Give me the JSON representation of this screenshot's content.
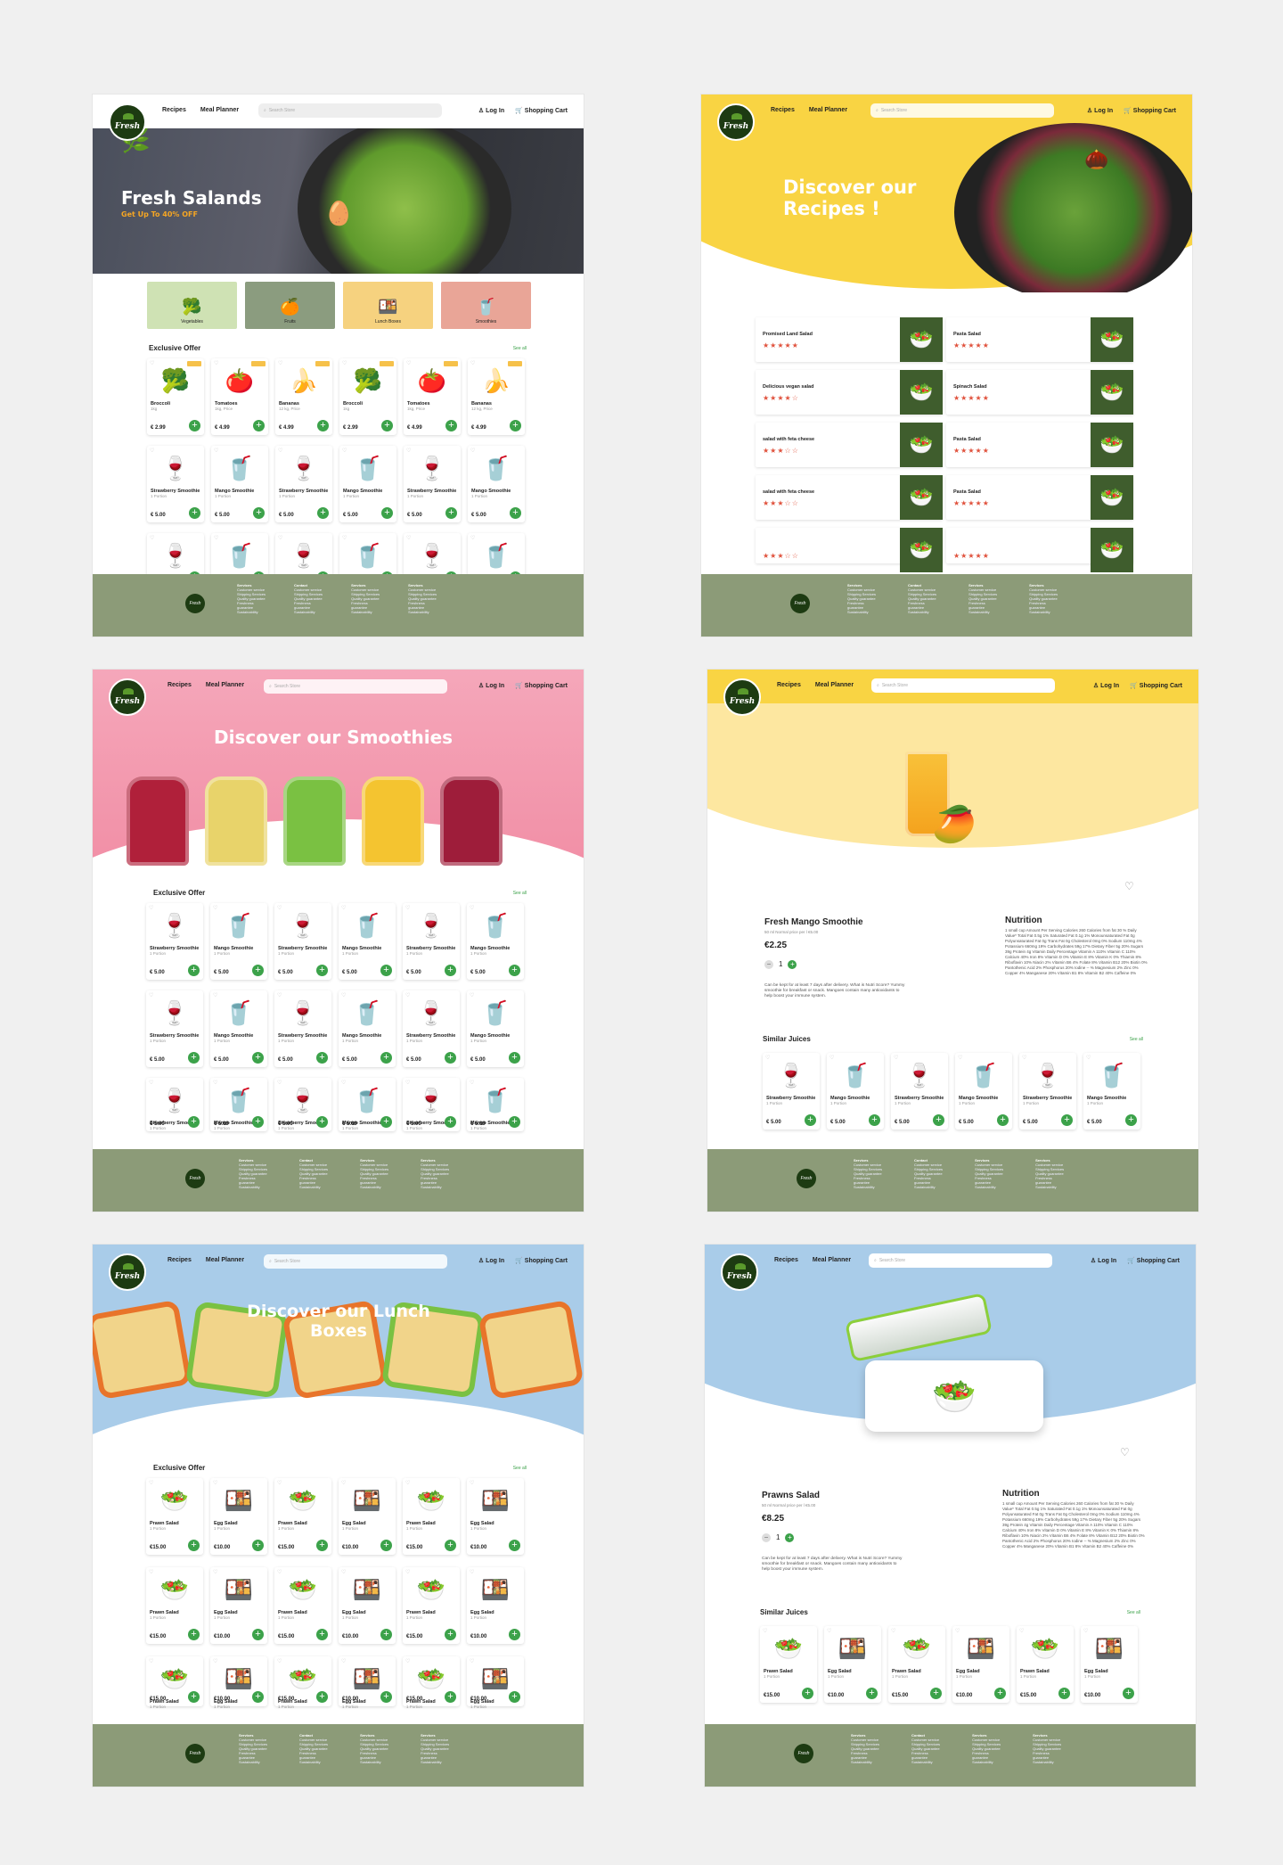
{
  "nav": {
    "links": [
      "Recipes",
      "Meal Planner"
    ],
    "search_placeholder": "Search Store",
    "login": "Log In",
    "cart": "Shopping Cart",
    "logo": "Fresh"
  },
  "colors": {
    "green": "#3ca24a",
    "footer": "#8c9b78",
    "yellow": "#f9d443",
    "pink": "#f3a3b5",
    "blue": "#a9cce9",
    "dark_green": "#1d3b12"
  },
  "page1": {
    "hero_title": "Fresh Salands",
    "hero_sub": "Get Up To 40% OFF",
    "categories": [
      {
        "label": "Vegetables",
        "icon": "broccoli-icon",
        "bg": "#cfe2b4"
      },
      {
        "label": "Fruits",
        "icon": "fruit-icon",
        "bg": "#8b9c7f"
      },
      {
        "label": "Lunch Boxes",
        "icon": "lunchbox-icon",
        "bg": "#f6d27f"
      },
      {
        "label": "Smoothies",
        "icon": "smoothie-icon",
        "bg": "#e9a597"
      }
    ],
    "section": "Exclusive Offer",
    "see_all": "See all",
    "row1": [
      {
        "name": "Broccoli",
        "sub": "1kg",
        "price": "€ 2.99",
        "icon": "🥦"
      },
      {
        "name": "Tomatoes",
        "sub": "1kg, Price",
        "price": "€ 4.99",
        "icon": "🍅"
      },
      {
        "name": "Bananas",
        "sub": "12 kg, Price",
        "price": "€ 4.99",
        "icon": "🍌"
      },
      {
        "name": "Broccoli",
        "sub": "1kg",
        "price": "€ 2.99",
        "icon": "🥦"
      },
      {
        "name": "Tomatoes",
        "sub": "1kg, Price",
        "price": "€ 4.99",
        "icon": "🍅"
      },
      {
        "name": "Bananas",
        "sub": "12 kg, Price",
        "price": "€ 4.99",
        "icon": "🍌"
      }
    ],
    "row2": [
      {
        "name": "Strawberry Smoothie",
        "sub": "1 Portion",
        "price": "€ 5.00",
        "icon": "🍷"
      },
      {
        "name": "Mango Smoothie",
        "sub": "1 Portion",
        "price": "€ 5.00",
        "icon": "🥤"
      },
      {
        "name": "Strawberry Smoothie",
        "sub": "1 Portion",
        "price": "€ 5.00",
        "icon": "🍷"
      },
      {
        "name": "Mango Smoothie",
        "sub": "1 Portion",
        "price": "€ 5.00",
        "icon": "🥤"
      },
      {
        "name": "Strawberry Smoothie",
        "sub": "1 Portion",
        "price": "€ 5.00",
        "icon": "🍷"
      },
      {
        "name": "Mango Smoothie",
        "sub": "1 Portion",
        "price": "€ 5.00",
        "icon": "🥤"
      }
    ]
  },
  "page2": {
    "hero_title": "Discover our Recipes !",
    "recipes_left": [
      {
        "name": "Promised Land Salad",
        "stars": "★★★★★"
      },
      {
        "name": "Delicious vegan salad",
        "stars": "★★★★☆"
      },
      {
        "name": "salad with feta cheese",
        "stars": "★★★☆☆"
      },
      {
        "name": "salad with feta cheese",
        "stars": "★★★☆☆"
      },
      {
        "name": "",
        "stars": "★★★☆☆"
      }
    ],
    "recipes_right": [
      {
        "name": "Pasta Salad",
        "stars": "★★★★★"
      },
      {
        "name": "Spinach Salad",
        "stars": "★★★★★"
      },
      {
        "name": "Pasta Salad",
        "stars": "★★★★★"
      },
      {
        "name": "Pasta Salad",
        "stars": "★★★★★"
      },
      {
        "name": "",
        "stars": "★★★★★"
      }
    ]
  },
  "page3": {
    "hero_title": "Discover our Smoothies",
    "section": "Exclusive Offer",
    "see_all": "See all"
  },
  "page4": {
    "product": "Fresh Mango Smoothie",
    "small": "50 ml Normal price per l €5.00",
    "price": "€2.25",
    "qty": "1",
    "desc": "Can be kept for at least 7 days after delivery. What is Nutri Score? Yummy smoothie for breakfast or snack. Mangoes contain many antioxidants to help boost your immune system.",
    "nutrition_title": "Nutrition",
    "nutrition": "1 small cup Amount Per Serving Calories 260 Calories from fat 30 % Daily Value* Total Fat 0.5g 1% Saturated Fat 0.1g 1% Monounsaturated Fat 0g Polyunsaturated Fat 0g Trans Fat 0g Cholesterol 0mg 0% Sodium 110mg 4% Potassium 660mg 19% Carbohydrates 59g 17% Dietary Fiber 5g 20% Sugars 39g Protein 4g Vitamin Daily Percentage Vitamin A 110% Vitamin C 110% Calcium 40% Iron 8% Vitamin D 0% Vitamin E 8% Vitamin K 0% Thiamin 8% Riboflavin 10% Niacin 2% Vitamin B6 4% Folate 8% Vitamin B12 20% Biotin 0% Pantothenic Acid 2% Phosphorus 20% Iodine -- % Magnesium 2% Zinc 0% Copper 4% Manganese 20% Vitamin B1 8% Vitamin B2 40% Caffeine 0%",
    "similar": "Similar Juices",
    "see_all": "See all"
  },
  "page5": {
    "hero_title": "Discover our Lunch Boxes",
    "section": "Exclusive Offer",
    "see_all": "See all",
    "items": [
      {
        "name": "Prawn Salad",
        "sub": "1 Portion",
        "price": "€15.00",
        "icon": "🥗"
      },
      {
        "name": "Egg Salad",
        "sub": "1 Portion",
        "price": "€10.00",
        "icon": "🍱"
      },
      {
        "name": "Prawn Salad",
        "sub": "1 Portion",
        "price": "€15.00",
        "icon": "🥗"
      },
      {
        "name": "Egg Salad",
        "sub": "1 Portion",
        "price": "€10.00",
        "icon": "🍱"
      },
      {
        "name": "Prawn Salad",
        "sub": "1 Portion",
        "price": "€15.00",
        "icon": "🥗"
      },
      {
        "name": "Egg Salad",
        "sub": "1 Portion",
        "price": "€10.00",
        "icon": "🍱"
      }
    ]
  },
  "page6": {
    "product": "Prawns Salad",
    "small": "50 ml Normal price per l €5.00",
    "price": "€8.25",
    "qty": "1",
    "similar": "Similar Juices",
    "see_all": "See all",
    "nutrition_title": "Nutrition"
  },
  "footer": {
    "cols": [
      {
        "h": "Services",
        "items": [
          "Customer service",
          "Shipping Services",
          "Quality guarantee",
          "Freshness",
          "guarantee",
          "Sustainability"
        ]
      },
      {
        "h": "Contact",
        "items": [
          "Customer service",
          "Shipping Services",
          "Quality guarantee",
          "Freshness",
          "guarantee",
          "Sustainability"
        ]
      },
      {
        "h": "Services",
        "items": [
          "Customer service",
          "Shipping Services",
          "Quality guarantee",
          "Freshness",
          "guarantee",
          "Sustainability"
        ]
      },
      {
        "h": "Services",
        "items": [
          "Customer service",
          "Shipping Services",
          "Quality guarantee",
          "Freshness",
          "guarantee",
          "Sustainability"
        ]
      }
    ]
  }
}
